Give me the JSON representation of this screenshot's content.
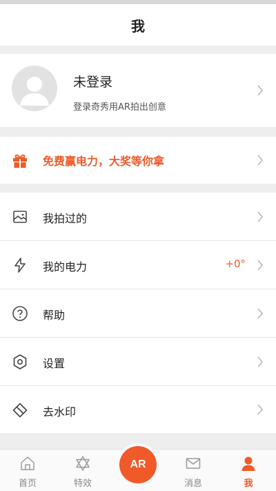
{
  "header": {
    "title": "我"
  },
  "profile": {
    "name": "未登录",
    "subtitle": "登录奇秀用AR拍出创意"
  },
  "promo": {
    "text": "免费赢电力，大奖等你拿"
  },
  "menu": {
    "items": [
      {
        "label": "我拍过的",
        "icon": "photo-icon"
      },
      {
        "label": "我的电力",
        "icon": "lightning-icon",
        "value": "+0°"
      },
      {
        "label": "帮助",
        "icon": "help-icon"
      },
      {
        "label": "设置",
        "icon": "settings-icon"
      },
      {
        "label": "去水印",
        "icon": "watermark-icon"
      }
    ]
  },
  "tabbar": {
    "tabs": [
      {
        "label": "首页",
        "icon": "home-icon"
      },
      {
        "label": "特效",
        "icon": "star-of-david-icon"
      },
      {
        "label": "消息",
        "icon": "mail-icon"
      },
      {
        "label": "我",
        "icon": "person-icon",
        "active": true
      }
    ],
    "center_button": "AR"
  },
  "colors": {
    "accent": "#f05a28",
    "icon_gray": "#555555"
  }
}
